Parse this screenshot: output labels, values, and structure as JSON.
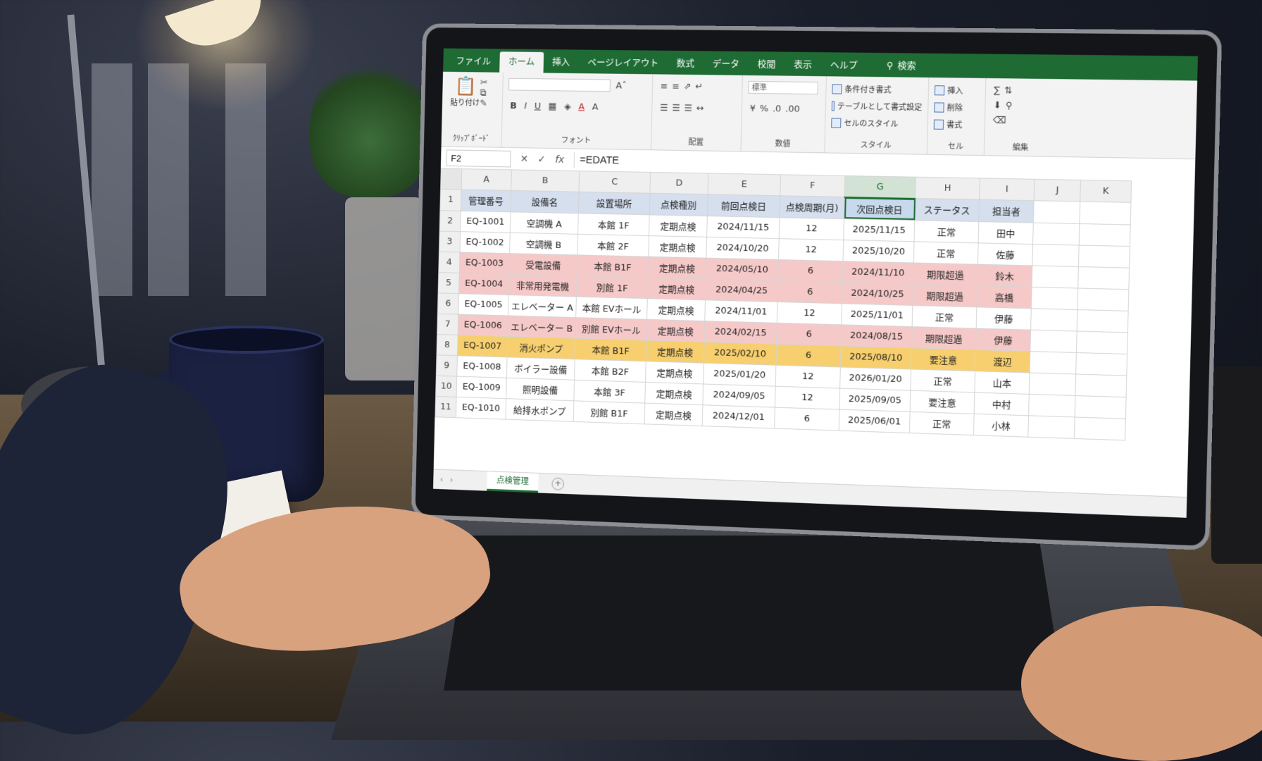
{
  "ribbon": {
    "tabs": [
      "ファイル",
      "ホーム",
      "挿入",
      "ページレイアウト",
      "数式",
      "データ",
      "校閲",
      "表示",
      "ヘルプ"
    ],
    "active_tab": "ホーム",
    "search_label": "検索",
    "clipboard": {
      "paste": "貼り付け",
      "label": "ｸﾘｯﾌﾟﾎﾞｰﾄﾞ"
    },
    "font_label": "フォント",
    "align_label": "配置",
    "number": {
      "format": "標準",
      "label": "数値"
    },
    "style": {
      "conditional": "条件付き書式",
      "table": "テーブルとして書式設定",
      "cell_style": "セルのスタイル",
      "label": "スタイル"
    },
    "cells": {
      "insert": "挿入",
      "delete": "削除",
      "format": "書式",
      "label": "セル"
    },
    "editing_label": "編集"
  },
  "formula_bar": {
    "name_box": "F2",
    "formula": "=EDATE",
    "fx": "fx"
  },
  "sheet": {
    "columns": [
      "A",
      "B",
      "C",
      "D",
      "E",
      "F",
      "G",
      "H",
      "I",
      "J",
      "K"
    ],
    "selected_column": "G",
    "headers": [
      "管理番号",
      "設備名",
      "設置場所",
      "点検種別",
      "前回点検日",
      "点検周期(月)",
      "次回点検日",
      "ステータス",
      "担当者"
    ],
    "rows": [
      {
        "n": "2",
        "hl": "",
        "cells": [
          "EQ-1001",
          "空調機 A",
          "本館 1F",
          "定期点検",
          "2024/11/15",
          "12",
          "2025/11/15",
          "正常",
          "田中"
        ]
      },
      {
        "n": "3",
        "hl": "",
        "cells": [
          "EQ-1002",
          "空調機 B",
          "本館 2F",
          "定期点検",
          "2024/10/20",
          "12",
          "2025/10/20",
          "正常",
          "佐藤"
        ]
      },
      {
        "n": "4",
        "hl": "red",
        "cells": [
          "EQ-1003",
          "受電設備",
          "本館 B1F",
          "定期点検",
          "2024/05/10",
          "6",
          "2024/11/10",
          "期限超過",
          "鈴木"
        ]
      },
      {
        "n": "5",
        "hl": "red",
        "cells": [
          "EQ-1004",
          "非常用発電機",
          "別館 1F",
          "定期点検",
          "2024/04/25",
          "6",
          "2024/10/25",
          "期限超過",
          "高橋"
        ]
      },
      {
        "n": "6",
        "hl": "",
        "cells": [
          "EQ-1005",
          "エレベーター A",
          "本館 EVホール",
          "定期点検",
          "2024/11/01",
          "12",
          "2025/11/01",
          "正常",
          "伊藤"
        ]
      },
      {
        "n": "7",
        "hl": "red",
        "cells": [
          "EQ-1006",
          "エレベーター B",
          "別館 EVホール",
          "定期点検",
          "2024/02/15",
          "6",
          "2024/08/15",
          "期限超過",
          "伊藤"
        ]
      },
      {
        "n": "8",
        "hl": "yellow",
        "cells": [
          "EQ-1007",
          "消火ポンプ",
          "本館 B1F",
          "定期点検",
          "2025/02/10",
          "6",
          "2025/08/10",
          "要注意",
          "渡辺"
        ]
      },
      {
        "n": "9",
        "hl": "",
        "cells": [
          "EQ-1008",
          "ボイラー設備",
          "本館 B2F",
          "定期点検",
          "2025/01/20",
          "12",
          "2026/01/20",
          "正常",
          "山本"
        ]
      },
      {
        "n": "10",
        "hl": "",
        "cells": [
          "EQ-1009",
          "照明設備",
          "本館 3F",
          "定期点検",
          "2024/09/05",
          "12",
          "2025/09/05",
          "要注意",
          "中村"
        ]
      },
      {
        "n": "11",
        "hl": "",
        "cells": [
          "EQ-1010",
          "給排水ポンプ",
          "別館 B1F",
          "定期点検",
          "2024/12/01",
          "6",
          "2025/06/01",
          "正常",
          "小林"
        ]
      }
    ],
    "header_row_number": "1"
  },
  "sheet_tabs": {
    "active": "点検管理",
    "add": "+"
  },
  "colors": {
    "accent_green": "#1e6b34",
    "overdue_red": "#f6c9c9",
    "caution_yellow": "#f7cf6e",
    "header_blue": "#d5dfee"
  }
}
